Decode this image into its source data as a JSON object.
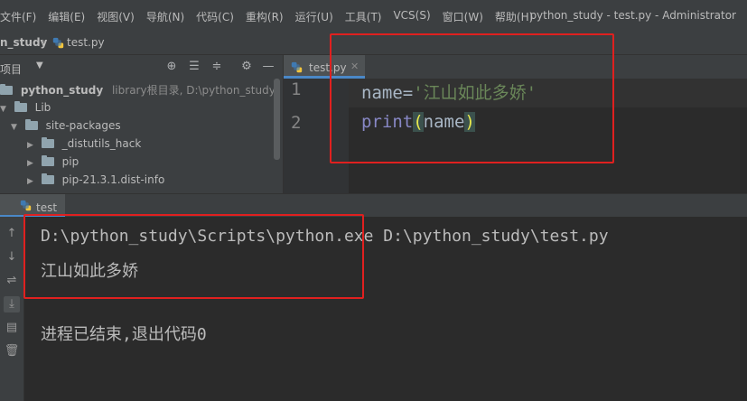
{
  "menubar": {
    "items": [
      "文件(F)",
      "编辑(E)",
      "视图(V)",
      "导航(N)",
      "代码(C)",
      "重构(R)",
      "运行(U)",
      "工具(T)",
      "VCS(S)",
      "窗口(W)",
      "帮助(H)"
    ],
    "window_title": "python_study - test.py - Administrator"
  },
  "breadcrumb": {
    "project": "n_study",
    "file": "test.py"
  },
  "project_panel": {
    "title": "项目",
    "icons": [
      "locate-icon",
      "expand-all-icon",
      "collapse-all-icon",
      "gear-icon",
      "hide-icon"
    ],
    "tree": [
      {
        "label": "python_study",
        "hint": "library根目录, D:\\python_study",
        "level": 0,
        "expanded": true,
        "bold": true
      },
      {
        "label": "Lib",
        "level": 1,
        "expanded": true
      },
      {
        "label": "site-packages",
        "level": 2,
        "expanded": true
      },
      {
        "label": "_distutils_hack",
        "level": 3,
        "expanded": false
      },
      {
        "label": "pip",
        "level": 3,
        "expanded": false
      },
      {
        "label": "pip-21.3.1.dist-info",
        "level": 3,
        "expanded": false
      }
    ]
  },
  "editor": {
    "tab_label": "test.py",
    "line_numbers": [
      "1",
      "2"
    ],
    "code": {
      "line1": {
        "var": "name",
        "op": "=",
        "str": "'江山如此多娇'"
      },
      "line2": {
        "func": "print",
        "open": "(",
        "arg": "name",
        "close": ")"
      }
    }
  },
  "run": {
    "tab_label": "test",
    "console": [
      "D:\\python_study\\Scripts\\python.exe D:\\python_study\\test.py",
      "江山如此多娇",
      "",
      "进程已结束,退出代码0"
    ]
  },
  "colors": {
    "annotation": "#e0201f",
    "accent": "#4a88c7"
  }
}
